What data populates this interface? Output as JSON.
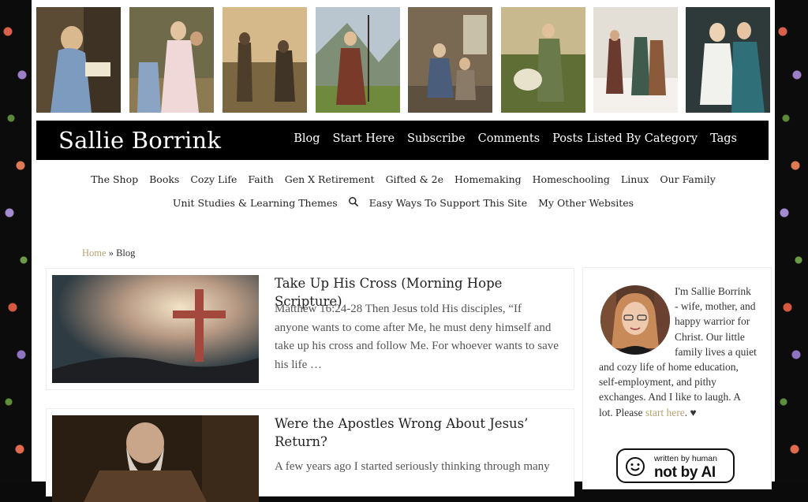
{
  "site": {
    "title": "Sallie Borrink"
  },
  "top_nav": [
    "Blog",
    "Start Here",
    "Subscribe",
    "Comments",
    "Posts Listed By Category",
    "Tags"
  ],
  "sub_nav_row1": [
    "The Shop",
    "Books",
    "Cozy Life",
    "Faith",
    "Gen X Retirement",
    "Gifted & 2e",
    "Homemaking",
    "Homeschooling",
    "Linux",
    "Our Family"
  ],
  "sub_nav_row2": [
    "Unit Studies & Learning Themes",
    "Easy Ways To Support This Site",
    "My Other Websites"
  ],
  "breadcrumb": {
    "home": "Home",
    "separator": "»",
    "current": "Blog"
  },
  "posts": [
    {
      "title": "Take Up His Cross (Morning Hope Scripture)",
      "excerpt": "Matthew 16:24-28 Then Jesus told His disciples, “If anyone wants to come after Me, he must deny himself and take up his cross and follow Me. For whoever wants to save his life …"
    },
    {
      "title": "Were the Apostles Wrong About Jesus’ Return?",
      "excerpt": "A few years ago I started seriously thinking through many"
    }
  ],
  "sidebar": {
    "bio_text": "I'm Sallie Borrink - wife, mother, and happy warrior for Christ. Our little family lives a quiet and cozy life of home education, self-employment, and pithy exchanges. And I like to laugh. A lot. Please ",
    "bio_link": "start here",
    "bio_end": ". ♥",
    "badge_line1": "written by human",
    "badge_line2": "not by AI"
  },
  "colors": {
    "accent": "#b4a370",
    "topbar": "#000000"
  },
  "icons": [
    "search-icon",
    "smiley-icon"
  ]
}
